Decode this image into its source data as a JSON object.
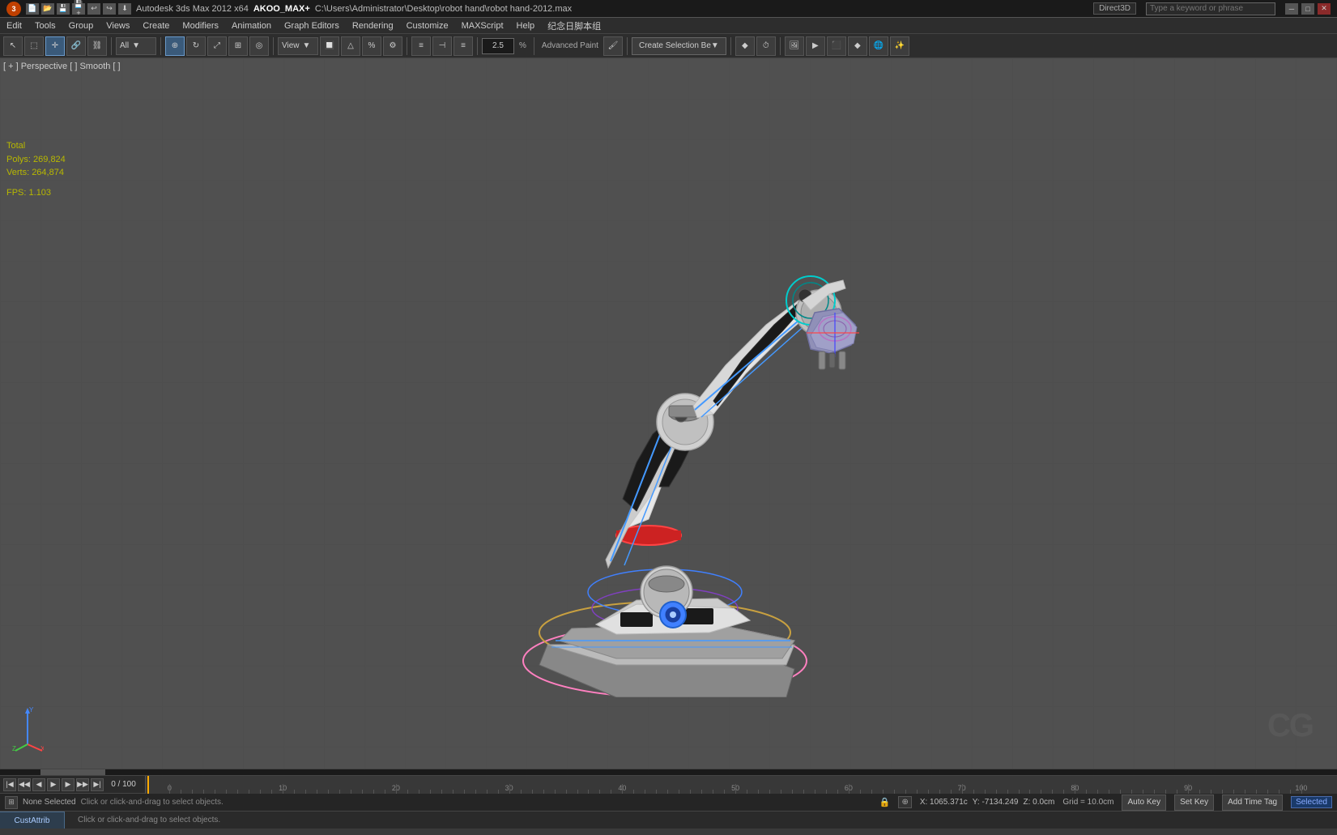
{
  "title_bar": {
    "app_name": "Autodesk 3ds Max 2012 x64",
    "project": "AKOO_MAX+",
    "file_path": "C:\\Users\\Administrator\\Desktop\\robot hand\\robot hand-2012.max",
    "renderer": "Direct3D",
    "search_placeholder": "Type a keyword or phrase"
  },
  "menu": {
    "items": [
      "Edit",
      "Tools",
      "Group",
      "Views",
      "Create",
      "Modifiers",
      "Animation",
      "Graph Editors",
      "Rendering",
      "Customize",
      "MAXScript",
      "Help",
      "纪念日脚本组"
    ]
  },
  "toolbar": {
    "all_dropdown": "All",
    "view_dropdown": "View",
    "advanced_paint": "Advanced Paint",
    "create_selection": "Create Selection Be",
    "percent_value": "2.5",
    "percent_suffix": "%"
  },
  "viewport": {
    "label": "[ + ] Perspective [ ] Smooth [ ]",
    "stats": {
      "total_label": "Total",
      "polys_label": "Polys:",
      "polys_value": "269,824",
      "verts_label": "Verts:",
      "verts_value": "264,874",
      "fps_label": "FPS:",
      "fps_value": "1.103"
    }
  },
  "timeline": {
    "counter": "0 / 100",
    "ticks": [
      0,
      10,
      20,
      30,
      40,
      50,
      60,
      70,
      80,
      90,
      100
    ]
  },
  "status_bar": {
    "selection": "None Selected",
    "hint": "Click or click-and-drag to select objects.",
    "x": "X: 1065.371c",
    "y": "Y: -7134.249",
    "z": "Z: 0.0cm",
    "grid": "Grid = 10.0cm",
    "auto_key": "Auto Key",
    "set_key": "Set Key",
    "add_time_tag": "Add Time Tag",
    "selected_label": "Selected"
  },
  "anim_controls": {
    "auto_key_label": "Auto Key",
    "set_key_label": "Set Key",
    "add_time_tag_label": "Add Time Tag",
    "selected_label": "Selected"
  },
  "cust_attrib": {
    "label": "CustAttrib"
  },
  "icons": {
    "undo": "↩",
    "redo": "↪",
    "new": "📄",
    "open": "📂",
    "save": "💾",
    "select": "↖",
    "move": "✛",
    "rotate": "↺",
    "scale": "⤢",
    "link": "🔗",
    "camera": "📷",
    "light": "💡",
    "lock": "🔒",
    "play": "▶",
    "stop": "⏹",
    "prev": "⏮",
    "next": "⏭",
    "key_left": "◀",
    "key_right": "▶",
    "chevron": "▼"
  }
}
